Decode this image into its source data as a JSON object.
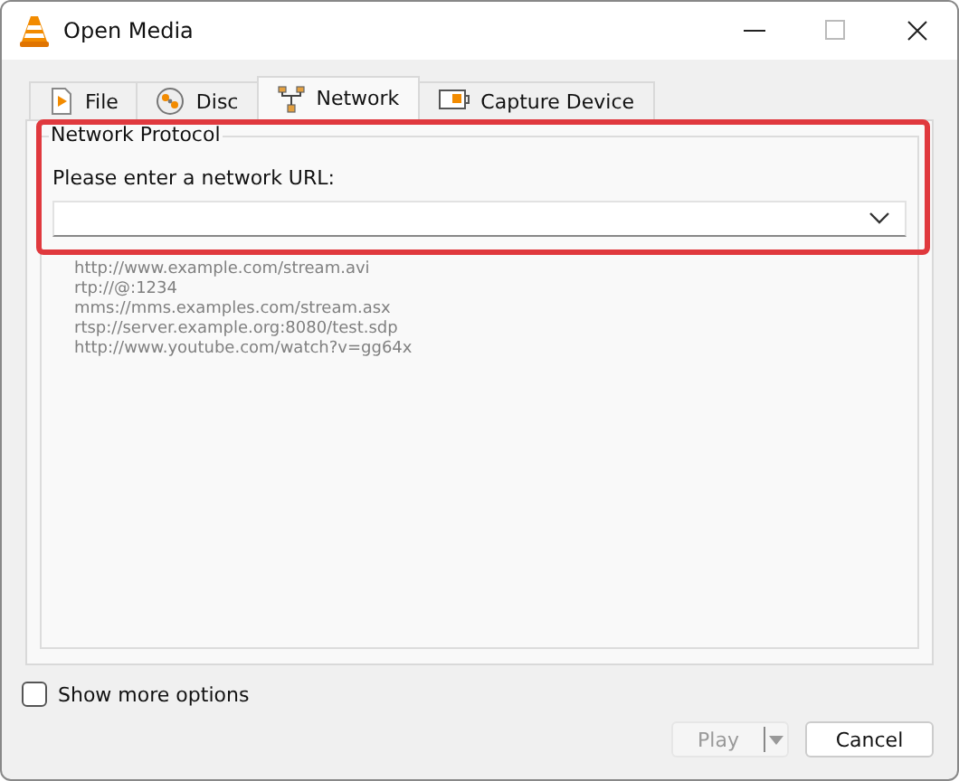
{
  "window": {
    "title": "Open Media"
  },
  "tabs": [
    {
      "label": "File",
      "kind": "file",
      "selected": false
    },
    {
      "label": "Disc",
      "kind": "disc",
      "selected": false
    },
    {
      "label": "Network",
      "kind": "network",
      "selected": true
    },
    {
      "label": "Capture Device",
      "kind": "capture",
      "selected": false
    }
  ],
  "network_protocol": {
    "title": "Network Protocol",
    "url_label": "Please enter a network URL:",
    "highlighted": true,
    "examples": [
      "http://www.example.com/stream.avi",
      "rtp://@:1234",
      "mms://mms.examples.com/stream.asx",
      "rtsp://server.example.org:8080/test.sdp",
      "http://www.youtube.com/watch?v=gg64x"
    ]
  },
  "show_more_options": {
    "label": "Show more options",
    "checked": false
  },
  "buttons": [
    {
      "label": "Play",
      "disabled": true,
      "split": true
    },
    {
      "label": "Cancel",
      "disabled": false,
      "split": false
    }
  ]
}
